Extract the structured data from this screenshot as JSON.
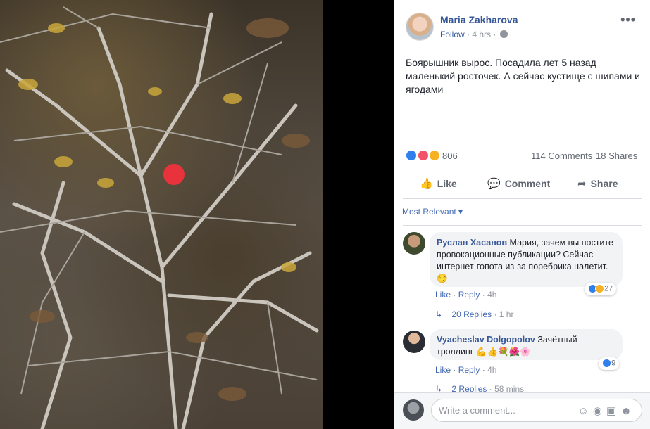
{
  "post": {
    "author": "Maria Zakharova",
    "follow": "Follow",
    "time": "4 hrs",
    "more_icon": "more-options-icon",
    "text": "Боярышник вырос. Посадила лет 5 назад маленький росточек. А сейчас кустище с шипами и ягодами",
    "reactions_count": "806",
    "comments_count": "114 Comments",
    "shares_count": "18 Shares"
  },
  "actions": {
    "like": "Like",
    "comment": "Comment",
    "share": "Share"
  },
  "sort": {
    "label": "Most Relevant"
  },
  "comments": [
    {
      "name": "Руслан Хасанов",
      "text": "Мария, зачем вы постите провокационные публикации? Сейчас интернет-гопота из-за поребрика налетит.",
      "emoji": "😏",
      "like": "Like",
      "reply": "Reply",
      "time": "4h",
      "reactions": "27",
      "replies": "20 Replies",
      "replies_time": "1 hr"
    },
    {
      "name": "Vyacheslav Dolgopolov",
      "text": "Зачётный троллинг",
      "emoji": "💪👍💐🌺🌸",
      "like": "Like",
      "reply": "Reply",
      "time": "4h",
      "reactions": "9",
      "replies": "2 Replies",
      "replies_time": "58 mins"
    }
  ],
  "composer": {
    "placeholder": "Write a comment..."
  },
  "colors": {
    "link": "#365899",
    "berry": "#e8323c"
  }
}
